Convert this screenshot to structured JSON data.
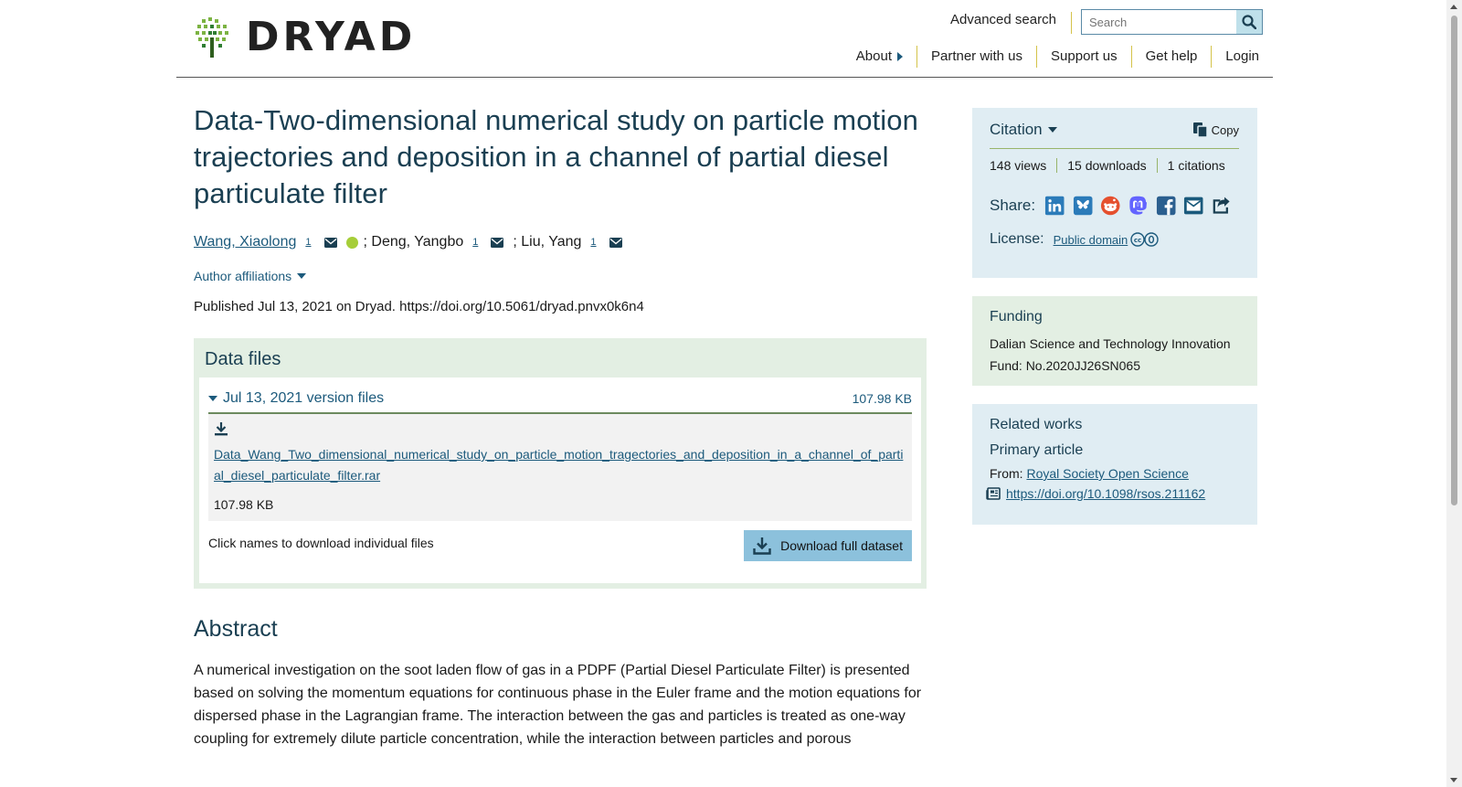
{
  "header": {
    "logo_text": "DRYAD",
    "advanced_search": "Advanced search",
    "search_placeholder": "Search",
    "nav": [
      "About",
      "Partner with us",
      "Support us",
      "Get help",
      "Login"
    ]
  },
  "dataset": {
    "title": "Data-Two-dimensional numerical study on particle motion trajectories and deposition in a channel of partial diesel particulate filter",
    "authors": [
      {
        "name": "Wang, Xiaolong",
        "affil": "1"
      },
      {
        "name": "Deng, Yangbo",
        "affil": "1"
      },
      {
        "name": "Liu, Yang",
        "affil": "1"
      }
    ],
    "author_sep": ";",
    "author_affiliations": "Author affiliations",
    "published": "Published Jul 13, 2021 on Dryad. https://doi.org/10.5061/dryad.pnvx0k6n4"
  },
  "data_files": {
    "heading": "Data files",
    "version_label": "Jul 13, 2021 version files",
    "version_size": "107.98 KB",
    "file_name": "Data_Wang_Two_dimensional_numerical_study_on_particle_motion_tragectories_and_deposition_in_a_channel_of_partial_diesel_particulate_filter.rar",
    "file_size": "107.98 KB",
    "hint": "Click names to download individual files",
    "download_button": "Download full dataset"
  },
  "abstract": {
    "heading": "Abstract",
    "text": "A numerical investigation on the soot laden flow of gas in a PDPF (Partial Diesel Particulate Filter) is presented based on solving the momentum equations for continuous phase in the Euler frame and the motion equations for dispersed phase in the Lagrangian frame. The interaction between the gas and particles is treated as one-way coupling for extremely dilute particle concentration, while the interaction between particles and porous"
  },
  "citation": {
    "title": "Citation",
    "copy": "Copy",
    "views": "148 views",
    "downloads": "15 downloads",
    "citations": "1 citations",
    "share_label": "Share:",
    "share_icons": [
      "linkedin-icon",
      "bluesky-icon",
      "reddit-icon",
      "mastodon-icon",
      "facebook-icon",
      "email-icon",
      "share-icon"
    ],
    "license_label": "License:",
    "license_link": "Public domain"
  },
  "funding": {
    "heading": "Funding",
    "text": "Dalian Science and Technology Innovation Fund: No.2020JJ26SN065"
  },
  "related": {
    "heading": "Related works",
    "subheading": "Primary article",
    "from_label": "From:",
    "from_link": "Royal Society Open Science",
    "doi_link": "https://doi.org/10.1098/rsos.211162"
  },
  "colors": {
    "brand_blue": "#1c5a7c",
    "heading_navy": "#1a3f52",
    "panel_blue": "#e0edf3",
    "panel_green": "#e3efe3",
    "button_blue": "#8cc1dc",
    "divider_yellow": "#d4c34a"
  }
}
